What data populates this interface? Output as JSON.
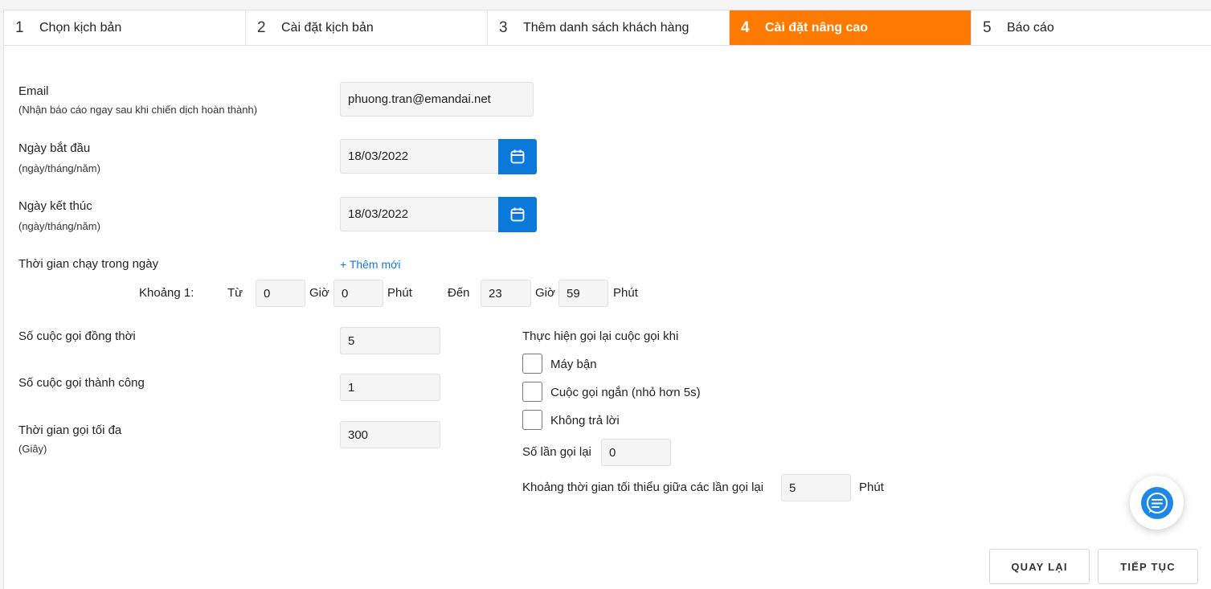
{
  "steps": [
    {
      "num": "1",
      "label": "Chọn kịch bản"
    },
    {
      "num": "2",
      "label": "Cài đặt kịch bản"
    },
    {
      "num": "3",
      "label": "Thêm danh sách khách hàng"
    },
    {
      "num": "4",
      "label": "Cài đặt nâng cao"
    },
    {
      "num": "5",
      "label": "Báo cáo"
    }
  ],
  "form": {
    "email_label": "Email",
    "email_sub": "(Nhận báo cáo ngay sau khi chiến dịch hoàn thành)",
    "email_value": "phuong.tran@emandai.net",
    "start_label": "Ngày bắt đầu",
    "start_sub": "(ngày/tháng/năm)",
    "start_value": "18/03/2022",
    "end_label": "Ngày kết thúc",
    "end_sub": "(ngày/tháng/năm)",
    "end_value": "18/03/2022",
    "runtime_label": "Thời gian chạy trong ngày",
    "add_new": "+ Thêm mới",
    "interval": {
      "label": "Khoảng 1:",
      "from": "Từ",
      "from_hour": "0",
      "hour_unit": "Giờ",
      "from_minute": "0",
      "minute_unit": "Phút",
      "to": "Đến",
      "to_hour": "23",
      "to_minute": "59"
    },
    "concurrent_label": "Số cuộc gọi đồng thời",
    "concurrent_value": "5",
    "success_label": "Số cuộc gọi thành công",
    "success_value": "1",
    "maxtime_label": "Thời gian gọi tối đa",
    "maxtime_sub": "(Giây)",
    "maxtime_value": "300"
  },
  "recall": {
    "title": "Thực hiện gọi lại cuộc gọi khi",
    "options": [
      "Máy bận",
      "Cuộc gọi ngắn (nhỏ hơn 5s)",
      "Không trả lời"
    ],
    "count_label": "Số lần gọi lại",
    "count_value": "0",
    "gap_label": "Khoảng thời gian tối thiểu giữa các lần gọi lại",
    "gap_value": "5",
    "gap_unit": "Phút"
  },
  "buttons": {
    "back": "QUAY LẠI",
    "next": "TIẾP TỤC"
  },
  "colors": {
    "active_step": "#ff7a00",
    "calendar_button": "#0b79d9",
    "link": "#1976d2",
    "chat": "#1e88e5"
  }
}
